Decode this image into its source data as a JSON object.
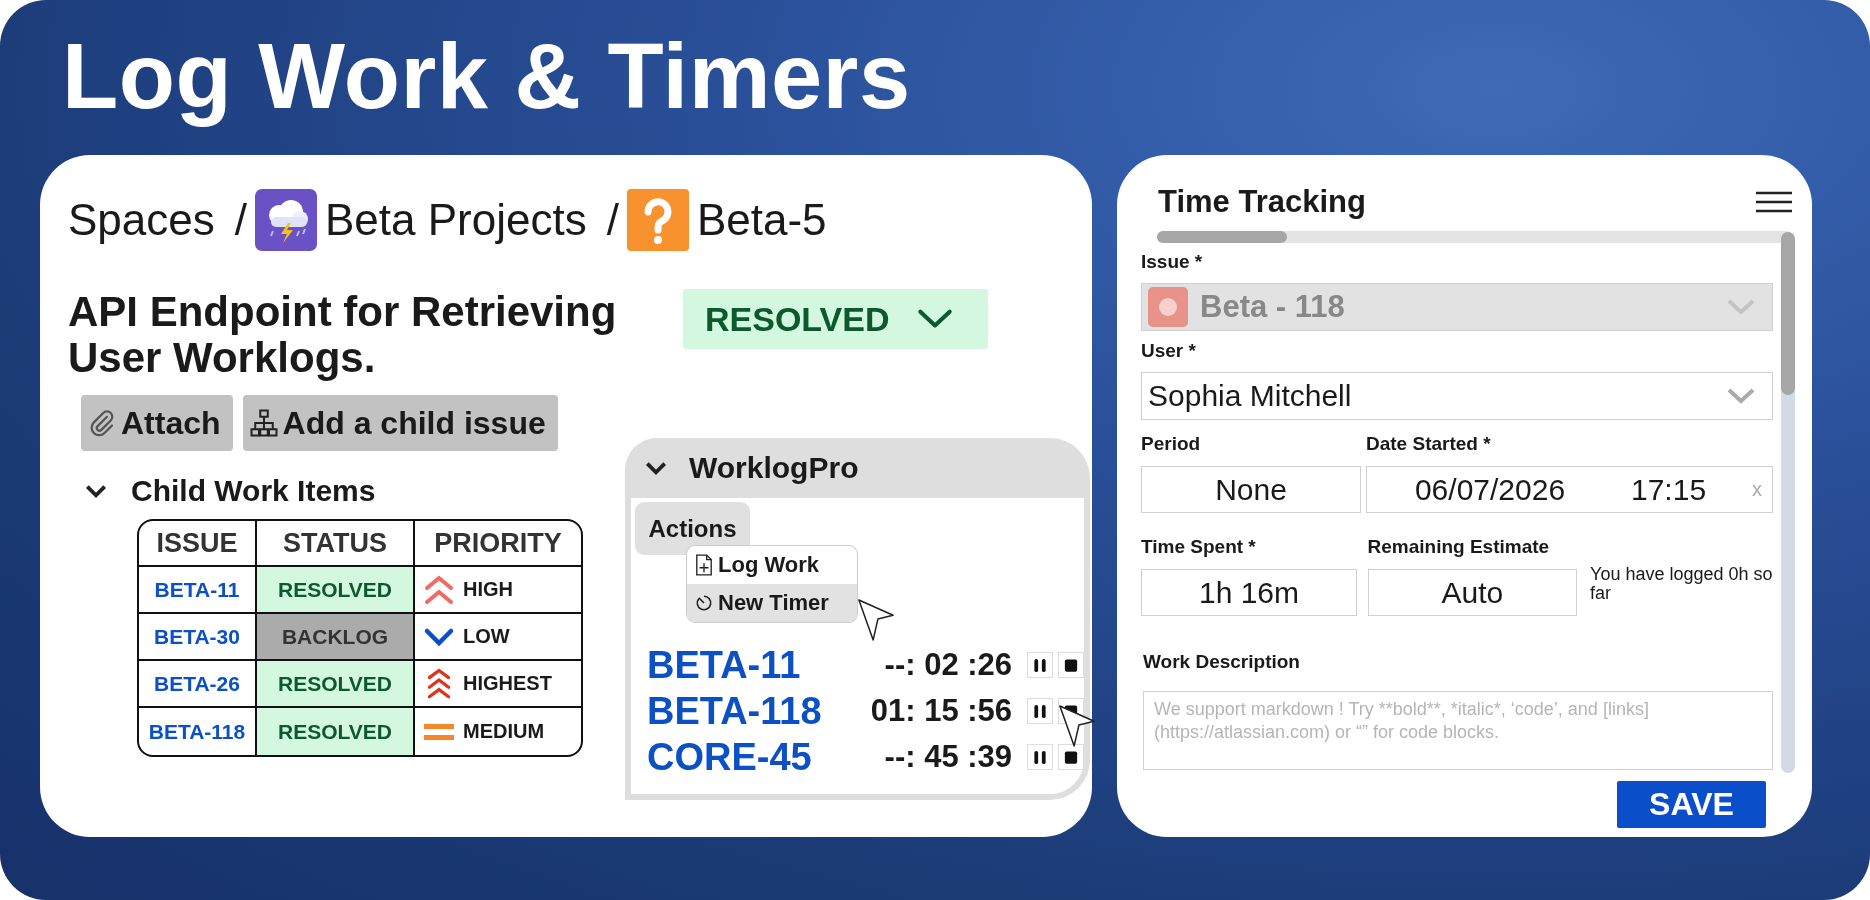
{
  "title": "Log Work & Timers",
  "issue_card": {
    "breadcrumbs": [
      {
        "label": "Spaces"
      },
      {
        "separator": "/",
        "label": "Beta Projects"
      },
      {
        "separator": "/",
        "label": "Beta-5"
      }
    ],
    "summary": "API Endpoint for Retrieving User Worklogs.",
    "status": "RESOLVED",
    "actions": [
      "Attach",
      "Add a child issue"
    ],
    "child_items": {
      "heading": "Child Work Items",
      "expanded": true,
      "columns": [
        "ISSUE",
        "STATUS",
        "PRIORITY"
      ],
      "rows": [
        {
          "issue": "BETA-11",
          "status": {
            "label": "RESOLVED",
            "kind": "resolved"
          },
          "priority": {
            "label": "HIGH",
            "kind": "high"
          }
        },
        {
          "issue": "BETA-30",
          "status": {
            "label": "BACKLOG",
            "kind": "backlog"
          },
          "priority": {
            "label": "LOW",
            "kind": "low"
          }
        },
        {
          "issue": "BETA-26",
          "status": {
            "label": "RESOLVED",
            "kind": "resolved"
          },
          "priority": {
            "label": "HIGHEST",
            "kind": "highest"
          }
        },
        {
          "issue": "BETA-118",
          "status": {
            "label": "RESOLVED",
            "kind": "resolved"
          },
          "priority": {
            "label": "MEDIUM",
            "kind": "medium"
          }
        }
      ]
    },
    "worklog_panel": {
      "title": "WorklogPro",
      "expanded": true,
      "actions_button": "Actions",
      "menu": [
        {
          "label": "Log Work",
          "kind": "log",
          "selected": false
        },
        {
          "label": "New Timer",
          "kind": "timer",
          "selected": true
        }
      ],
      "timers": [
        {
          "issue": "BETA-11",
          "time": "--: 02 :26"
        },
        {
          "issue": "BETA-118",
          "time": "01: 15 :56"
        },
        {
          "issue": "CORE-45",
          "time": "--: 45 :39"
        }
      ]
    }
  },
  "time_tracking": {
    "title": "Time Tracking",
    "issue": {
      "label": "Issue *",
      "value": "Beta - 118",
      "disabled": true
    },
    "user": {
      "label": "User *",
      "value": "Sophia Mitchell",
      "disabled": false
    },
    "period": {
      "label": "Period",
      "value": "None"
    },
    "date_started": {
      "label": "Date Started *",
      "date": "06/07/2026",
      "time": "17:15",
      "clear": "x"
    },
    "time_spent": {
      "label": "Time Spent *",
      "value": "1h 16m"
    },
    "remaining_estimate": {
      "label": "Remaining Estimate",
      "value": "Auto"
    },
    "logged_note": "You have logged 0h so far",
    "work_description": {
      "label": "Work Description",
      "placeholder": "We support markdown ! Try **bold**, *italic*, ‘code’, and [links](https://atlassian.com) or “” for code blocks."
    },
    "save": "SAVE"
  }
}
